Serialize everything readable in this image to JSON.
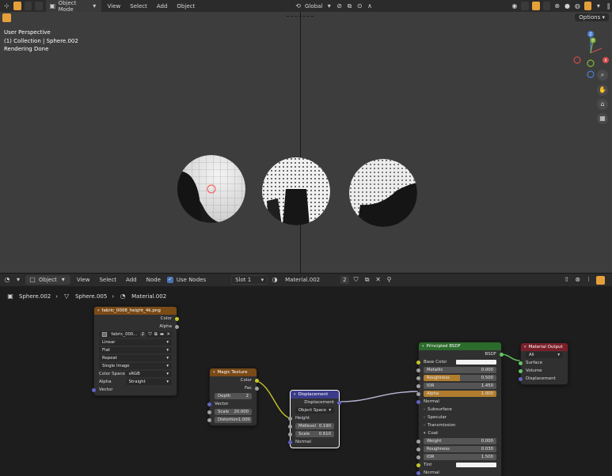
{
  "top_header": {
    "mode": "Object Mode",
    "menus": [
      "View",
      "Select",
      "Add",
      "Object"
    ],
    "transform_orientation": "Global",
    "options": "Options"
  },
  "viewport": {
    "info": [
      "User Perspective",
      "(1) Collection | Sphere.002",
      "Rendering Done"
    ],
    "axes": {
      "x": "X",
      "y": "Y",
      "z": "Z"
    }
  },
  "node_header": {
    "editor_type": "Object",
    "menus": [
      "View",
      "Select",
      "Add",
      "Node"
    ],
    "use_nodes_label": "Use Nodes",
    "slot": "Slot 1",
    "material": "Material.002",
    "user_count": "2"
  },
  "breadcrumb": [
    "Sphere.002",
    "Sphere.005",
    "Material.002"
  ],
  "nodes": {
    "image": {
      "title": "fabric_0008_height_4k.png",
      "outputs": [
        "Color",
        "Alpha"
      ],
      "image_name": "fabric_000...",
      "users": "2",
      "interpolation": "Linear",
      "projection": "Flat",
      "extension": "Repeat",
      "source": "Single Image",
      "color_space_label": "Color Space",
      "color_space": "sRGB",
      "alpha_label": "Alpha",
      "alpha": "Straight",
      "vector": "Vector"
    },
    "magic": {
      "title": "Magic Texture",
      "outputs": [
        "Color",
        "Fac"
      ],
      "depth_label": "Depth",
      "depth": "2",
      "vector": "Vector",
      "scale_label": "Scale",
      "scale": "20.000",
      "distortion_label": "Distortion",
      "distortion": "1.000"
    },
    "displacement": {
      "title": "Displacement",
      "output": "Displacement",
      "space": "Object Space",
      "height": "Height",
      "midlevel_label": "Midlevel",
      "midlevel": "0.190",
      "scale_label": "Scale",
      "scale": "0.610",
      "normal": "Normal"
    },
    "bsdf": {
      "title": "Principled BSDF",
      "output": "BSDF",
      "base_color": "Base Color",
      "metallic_label": "Metallic",
      "metallic": "0.000",
      "roughness_label": "Roughness",
      "roughness": "0.500",
      "ior_label": "IOR",
      "ior": "1.450",
      "alpha_label": "Alpha",
      "alpha": "1.000",
      "normal": "Normal",
      "subsurface": "Subsurface",
      "specular": "Specular",
      "transmission": "Transmission",
      "coat": "Coat",
      "weight_label": "Weight",
      "weight": "0.000",
      "coat_roughness_label": "Roughness",
      "coat_roughness": "0.030",
      "coat_ior_label": "IOR",
      "coat_ior": "1.500",
      "tint": "Tint",
      "coat_normal": "Normal"
    },
    "output": {
      "title": "Material Output",
      "target": "All",
      "inputs": [
        "Surface",
        "Volume",
        "Displacement"
      ]
    }
  },
  "colors": {
    "image_header": "#7a4a17",
    "magic_header": "#7a4a17",
    "displacement_header": "#3b3b8c",
    "bsdf_header": "#2b6b2b",
    "output_header": "#7a1f2a",
    "accent": "#e6a03a"
  }
}
